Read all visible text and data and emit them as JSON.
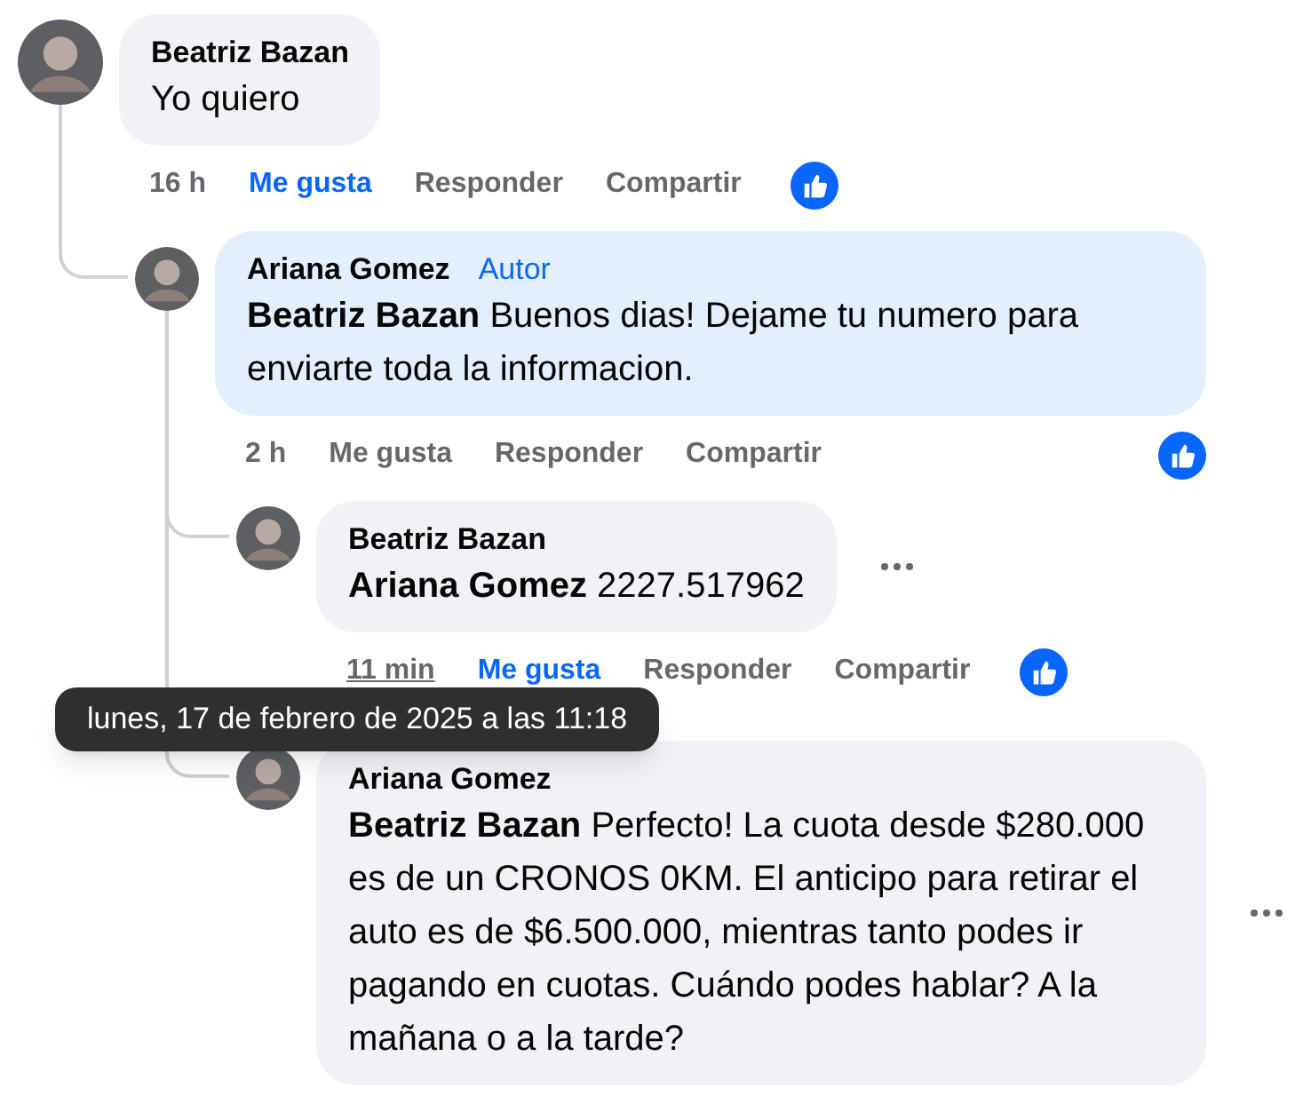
{
  "comments": [
    {
      "author": "Beatriz Bazan",
      "highlighted": false,
      "text": "Yo quiero",
      "time": "16 h",
      "liked": true,
      "actions": [
        "Me gusta",
        "Responder",
        "Compartir"
      ],
      "has_reaction": true,
      "more_options": false,
      "children": [
        {
          "author": "Ariana Gomez",
          "badge": "Autor",
          "highlighted": true,
          "text": "**Beatriz Bazan** Buenos dias! Dejame tu numero para enviarte toda la informacion.",
          "time": "2 h",
          "liked": false,
          "actions": [
            "Me gusta",
            "Responder",
            "Compartir"
          ],
          "has_reaction": true,
          "more_options": false,
          "children": [
            {
              "author": "Beatriz Bazan",
              "highlighted": false,
              "text": "**Ariana Gomez** 2227.517962",
              "time": "11 min",
              "time_tooltip": "lunes, 17 de febrero de 2025 a las 11:18",
              "liked": true,
              "actions": [
                "Me gusta",
                "Responder",
                "Compartir"
              ],
              "has_reaction": true,
              "more_options": true
            },
            {
              "author": "Ariana Gomez",
              "highlighted": false,
              "text": "**Beatriz Bazan** Perfecto! La cuota desde $280.000 es de un CRONOS 0KM. El anticipo para retirar el auto es de $6.500.000, mientras tanto podes ir pagando en cuotas. Cuándo podes hablar? A la mañana o a la tarde?",
              "has_reaction": false,
              "more_options": true
            }
          ]
        }
      ]
    }
  ]
}
